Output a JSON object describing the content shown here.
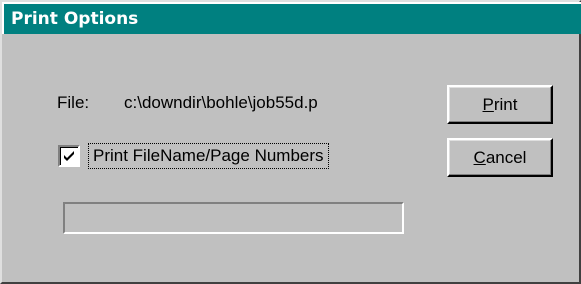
{
  "window": {
    "title": "Print Options"
  },
  "file": {
    "label": "File:",
    "path": "c:\\downdir\\bohle\\job55d.p"
  },
  "options": {
    "print_filename_label": "Print FileName/Page Numbers",
    "print_filename_checked": true
  },
  "buttons": {
    "print_label": "Print",
    "cancel_label": "Cancel"
  },
  "progress": {
    "value": 0
  },
  "colors": {
    "titlebar": "#008080",
    "dialog_face": "#c0c0c0"
  }
}
